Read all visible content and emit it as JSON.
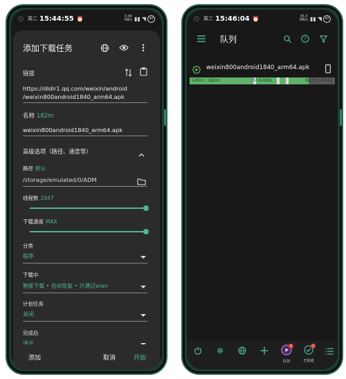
{
  "left_phone": {
    "statusbar": {
      "day": "周二",
      "time": "15:44:55",
      "net_top": "0.06",
      "net_bottom": "KB/s",
      "battery": "40"
    },
    "dialog": {
      "title": "添加下载任务",
      "link": {
        "label": "链接",
        "line1": "https://dldir1.qq.com/weixin/android",
        "line2": "/weixin800android1840_arm64.apk"
      },
      "name": {
        "label": "名称",
        "size": "182m",
        "value": "weixin800android1840_arm64.apk"
      },
      "advanced": {
        "label": "高级选项（路径、速度等）"
      },
      "path": {
        "label": "路径",
        "hint": "默认",
        "value": "/storage/emulated/0/ADM"
      },
      "threads": {
        "label": "线程数",
        "value": "2047",
        "fraction": 1.0
      },
      "speed": {
        "label": "下载速度",
        "value": "MAX",
        "fraction": 1.0
      },
      "category": {
        "label": "分类",
        "value": "程序"
      },
      "downloading": {
        "label": "下载中",
        "value": "智能下载 • 自动恢复 • 只通过wlan"
      },
      "schedule": {
        "label": "计划任务",
        "value": "关闭"
      },
      "on_complete": {
        "label": "完成后",
        "value": "退出"
      },
      "footer": {
        "add": "添加",
        "cancel": "取消",
        "start": "开始"
      }
    }
  },
  "right_phone": {
    "statusbar": {
      "day": "周二",
      "time": "15:46:04",
      "net_top": "35.3",
      "net_bottom": "MB/s",
      "battery": "40"
    },
    "appbar": {
      "title": "队列"
    },
    "task": {
      "name": "weixin800android1840_arm64.apk",
      "progress_text": "149m / 182m",
      "speed": "37.6mB/s",
      "time": "00:05 / 00:02",
      "progress": 0.82
    },
    "bottombar": {
      "queue_label": "队列",
      "queue_badge": "1",
      "done_label": "已完成",
      "done_badge": "2"
    }
  },
  "colors": {
    "accent": "#4fb39a",
    "progress_green": "#5fb36a",
    "frame": "#2c6653"
  }
}
